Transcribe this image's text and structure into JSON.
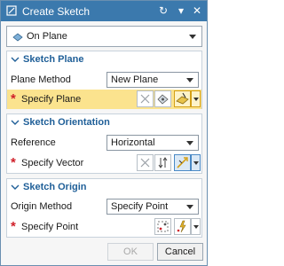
{
  "window": {
    "title": "Create Sketch"
  },
  "type_select": {
    "value": "On Plane"
  },
  "sketch_plane": {
    "title": "Sketch Plane",
    "plane_method_label": "Plane Method",
    "plane_method_value": "New Plane",
    "specify_plane_label": "Specify Plane"
  },
  "sketch_orientation": {
    "title": "Sketch Orientation",
    "reference_label": "Reference",
    "reference_value": "Horizontal",
    "specify_vector_label": "Specify Vector"
  },
  "sketch_origin": {
    "title": "Sketch Origin",
    "origin_method_label": "Origin Method",
    "origin_method_value": "Specify Point",
    "specify_point_label": "Specify Point"
  },
  "footer": {
    "ok_label": "OK",
    "cancel_label": "Cancel"
  },
  "colors": {
    "titlebar": "#3b79ad",
    "section_title": "#1f5f98",
    "highlight": "#fbe38e",
    "required": "#d0202a"
  }
}
